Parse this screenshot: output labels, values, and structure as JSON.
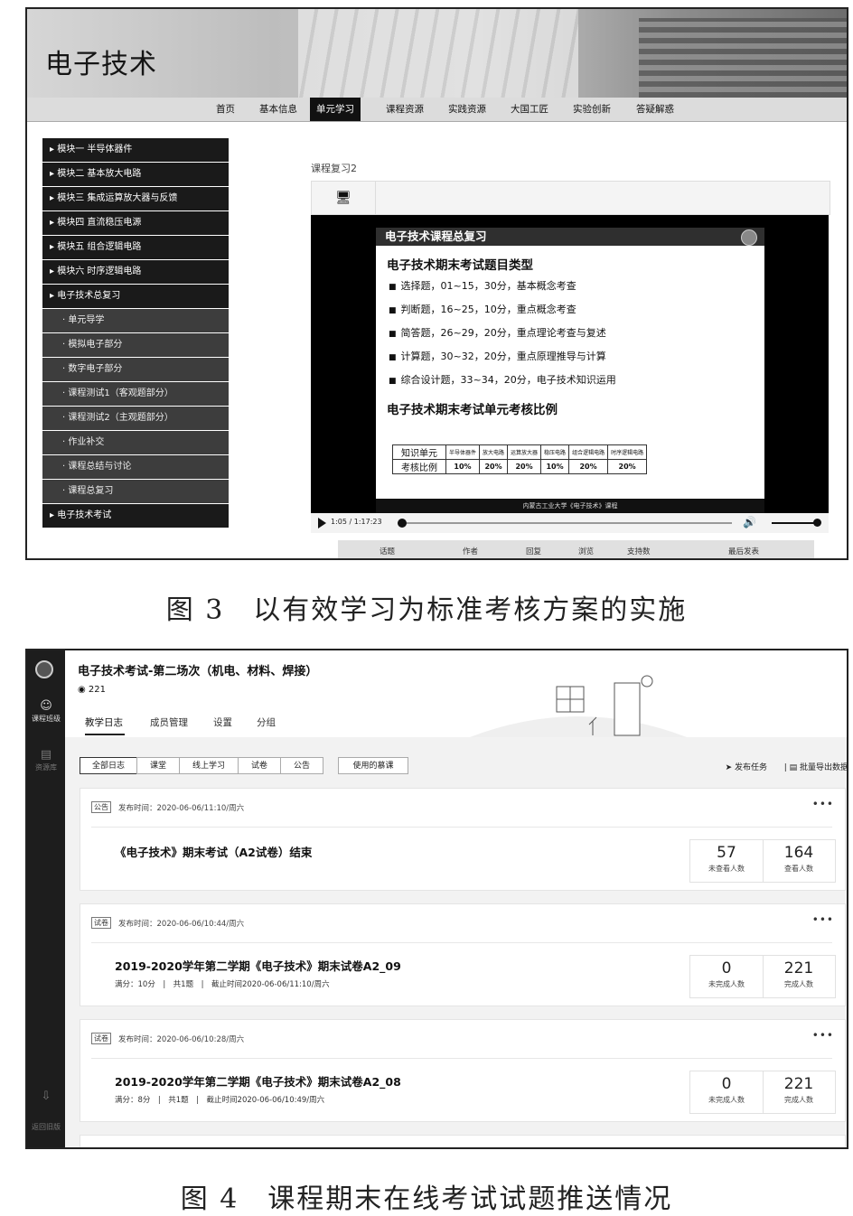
{
  "figure3": {
    "site_title": "电子技术",
    "nav": [
      "首页",
      "基本信息",
      "单元学习",
      "课程资源",
      "实践资源",
      "大国工匠",
      "实验创新",
      "答疑解惑"
    ],
    "nav_active": "单元学习",
    "sidebar": {
      "modules": [
        "模块一 半导体器件",
        "模块二 基本放大电路",
        "模块三 集成运算放大器与反馈",
        "模块四 直流稳压电源",
        "模块五 组合逻辑电路",
        "模块六 时序逻辑电路",
        "电子技术总复习"
      ],
      "subitems": [
        "单元导学",
        "模拟电子部分",
        "数字电子部分",
        "课程测试1（客观题部分）",
        "课程测试2（主观题部分）",
        "作业补交",
        "课程总结与讨论",
        "课程总复习"
      ],
      "last": "电子技术考试"
    },
    "lesson_label": "课程复习2",
    "slide": {
      "header": "电子技术课程总复习",
      "heading1": "电子技术期末考试题目类型",
      "bullets": [
        "选择题，01~15，30分，基本概念考查",
        "判断题，16~25，10分，重点概念考查",
        "简答题，26~29，20分，重点理论考查与复述",
        "计算题，30~32，20分，重点原理推导与计算",
        "综合设计题，33~34，20分，电子技术知识运用"
      ],
      "heading2": "电子技术期末考试单元考核比例",
      "table": {
        "row1_label": "知识单元",
        "row2_label": "考核比例",
        "units": [
          "半导体器件",
          "放大电路",
          "运算放大器",
          "稳压电路",
          "组合逻辑电路",
          "时序逻辑电路"
        ],
        "ratios": [
          "10%",
          "20%",
          "20%",
          "10%",
          "20%",
          "20%"
        ]
      },
      "footer": "内蒙古工业大学《电子技术》课程"
    },
    "player": {
      "time": "1:05 / 1:17:23",
      "progress": 0.014
    },
    "forum_headers": [
      "话题",
      "作者",
      "回复",
      "浏览",
      "支持数",
      "最后发表"
    ],
    "caption": "图 3　以有效学习为标准考核方案的实施"
  },
  "figure4": {
    "rail": {
      "class_label": "课程班级",
      "library_label": "资源库",
      "back_label": "返回旧版"
    },
    "course_title": "电子技术考试-第二场次（机电、材料、焊接）",
    "member_count": "221",
    "tabs": [
      "教学日志",
      "成员管理",
      "设置",
      "分组"
    ],
    "filters": [
      "全部日志",
      "课堂",
      "线上学习",
      "试卷",
      "公告"
    ],
    "used_resources": "使用的慕课",
    "publish_task": "发布任务",
    "batch_export": "批量导出数据",
    "cards": [
      {
        "badge": "公告",
        "published": "发布时间：2020-06-06/11:10/周六",
        "title": "《电子技术》期末考试（A2试卷）结束",
        "meta": "",
        "stat1_value": "57",
        "stat1_label": "未查看人数",
        "stat2_value": "164",
        "stat2_label": "查看人数"
      },
      {
        "badge": "试卷",
        "published": "发布时间：2020-06-06/10:44/周六",
        "title": "2019-2020学年第二学期《电子技术》期末试卷A2_09",
        "meta": "满分：10分　|　共1题　|　截止时间2020-06-06/11:10/周六",
        "stat1_value": "0",
        "stat1_label": "未完成人数",
        "stat2_value": "221",
        "stat2_label": "完成人数"
      },
      {
        "badge": "试卷",
        "published": "发布时间：2020-06-06/10:28/周六",
        "title": "2019-2020学年第二学期《电子技术》期末试卷A2_08",
        "meta": "满分：8分　|　共1题　|　截止时间2020-06-06/10:49/周六",
        "stat1_value": "0",
        "stat1_label": "未完成人数",
        "stat2_value": "221",
        "stat2_label": "完成人数"
      }
    ],
    "more": "•••",
    "caption": "图 4　课程期末在线考试试题推送情况"
  }
}
